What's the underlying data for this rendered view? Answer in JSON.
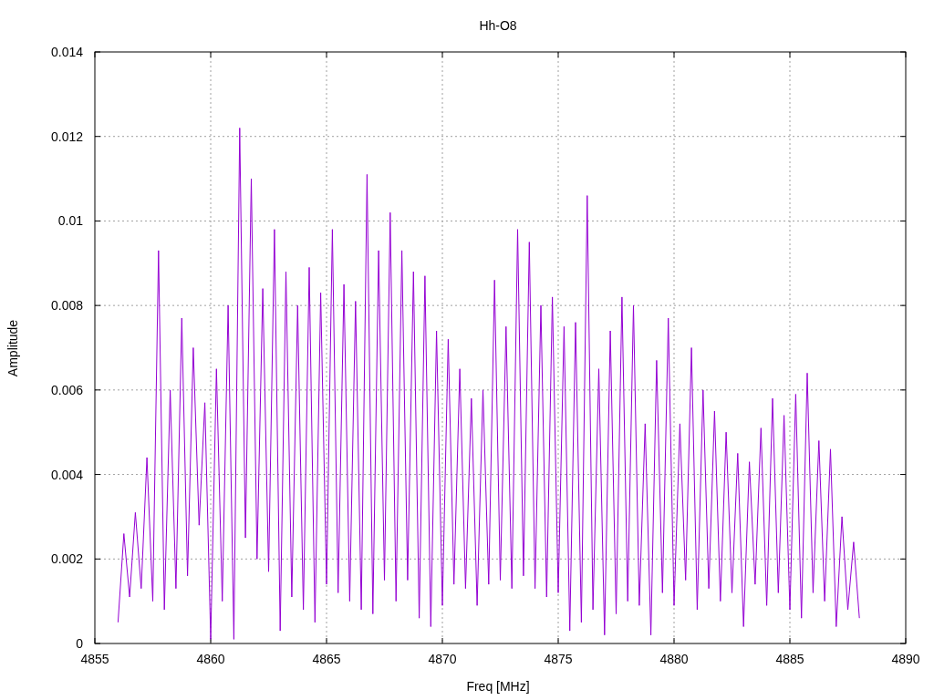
{
  "chart": {
    "chart_data": {
      "type": "line",
      "grid": true,
      "title": "Hh-O8",
      "xlabel": "Freq [MHz]",
      "ylabel": "Amplitude",
      "xlim": [
        4855,
        4890
      ],
      "ylim": [
        0,
        0.014
      ],
      "xticks": [
        4855,
        4860,
        4865,
        4870,
        4875,
        4880,
        4885,
        4890
      ],
      "yticks": [
        {
          "value": 0,
          "label": "0"
        },
        {
          "value": 0.002,
          "label": "0.002"
        },
        {
          "value": 0.004,
          "label": "0.004"
        },
        {
          "value": 0.006,
          "label": "0.006"
        },
        {
          "value": 0.008,
          "label": "0.008"
        },
        {
          "value": 0.01,
          "label": "0.01"
        },
        {
          "value": 0.012,
          "label": "0.012"
        },
        {
          "value": 0.014,
          "label": "0.014"
        }
      ],
      "x": [
        4856,
        4856.25,
        4856.5,
        4856.75,
        4857,
        4857.25,
        4857.5,
        4857.75,
        4858,
        4858.25,
        4858.5,
        4858.75,
        4859,
        4859.25,
        4859.5,
        4859.75,
        4860,
        4860.25,
        4860.5,
        4860.75,
        4861,
        4861.25,
        4861.5,
        4861.75,
        4862,
        4862.25,
        4862.5,
        4862.75,
        4863,
        4863.25,
        4863.5,
        4863.75,
        4864,
        4864.25,
        4864.5,
        4864.75,
        4865,
        4865.25,
        4865.5,
        4865.75,
        4866,
        4866.25,
        4866.5,
        4866.75,
        4867,
        4867.25,
        4867.5,
        4867.75,
        4868,
        4868.25,
        4868.5,
        4868.75,
        4869,
        4869.25,
        4869.5,
        4869.75,
        4870,
        4870.25,
        4870.5,
        4870.75,
        4871,
        4871.25,
        4871.5,
        4871.75,
        4872,
        4872.25,
        4872.5,
        4872.75,
        4873,
        4873.25,
        4873.5,
        4873.75,
        4874,
        4874.25,
        4874.5,
        4874.75,
        4875,
        4875.25,
        4875.5,
        4875.75,
        4876,
        4876.25,
        4876.5,
        4876.75,
        4877,
        4877.25,
        4877.5,
        4877.75,
        4878,
        4878.25,
        4878.5,
        4878.75,
        4879,
        4879.25,
        4879.5,
        4879.75,
        4880,
        4880.25,
        4880.5,
        4880.75,
        4881,
        4881.25,
        4881.5,
        4881.75,
        4882,
        4882.25,
        4882.5,
        4882.75,
        4883,
        4883.25,
        4883.5,
        4883.75,
        4884,
        4884.25,
        4884.5,
        4884.75,
        4885,
        4885.25,
        4885.5,
        4885.75,
        4886,
        4886.25,
        4886.5,
        4886.75,
        4887,
        4887.25,
        4887.5,
        4887.75,
        4888
      ],
      "series": [
        {
          "color": "#9400d3",
          "values": [
            0.0005,
            0.0026,
            0.0011,
            0.0031,
            0.0013,
            0.0044,
            0.001,
            0.0093,
            0.0008,
            0.006,
            0.0013,
            0.0077,
            0.0016,
            0.007,
            0.0028,
            0.0057,
            0.0001,
            0.0065,
            0.001,
            0.008,
            0.0001,
            0.0122,
            0.0025,
            0.011,
            0.002,
            0.0084,
            0.0017,
            0.0098,
            0.0003,
            0.0088,
            0.0011,
            0.008,
            0.0008,
            0.0089,
            0.0005,
            0.0083,
            0.0014,
            0.0098,
            0.0012,
            0.0085,
            0.001,
            0.0081,
            0.0008,
            0.0111,
            0.0007,
            0.0093,
            0.0015,
            0.0102,
            0.001,
            0.0093,
            0.0015,
            0.0088,
            0.0006,
            0.0087,
            0.0004,
            0.0074,
            0.0009,
            0.0072,
            0.0014,
            0.0065,
            0.0013,
            0.0058,
            0.0009,
            0.006,
            0.0014,
            0.0086,
            0.0015,
            0.0075,
            0.0013,
            0.0098,
            0.0016,
            0.0095,
            0.0013,
            0.008,
            0.0011,
            0.0082,
            0.0012,
            0.0075,
            0.0003,
            0.0076,
            0.0005,
            0.0106,
            0.0008,
            0.0065,
            0.0002,
            0.0074,
            0.0007,
            0.0082,
            0.001,
            0.008,
            0.0009,
            0.0052,
            0.0002,
            0.0067,
            0.0012,
            0.0077,
            0.0009,
            0.0052,
            0.0015,
            0.007,
            0.0008,
            0.006,
            0.0013,
            0.0055,
            0.001,
            0.005,
            0.0012,
            0.0045,
            0.0004,
            0.0043,
            0.0014,
            0.0051,
            0.0009,
            0.0058,
            0.0012,
            0.0054,
            0.0008,
            0.0059,
            0.0006,
            0.0064,
            0.0012,
            0.0048,
            0.001,
            0.0046,
            0.0004,
            0.003,
            0.0008,
            0.0024,
            0.0006
          ]
        }
      ]
    }
  }
}
